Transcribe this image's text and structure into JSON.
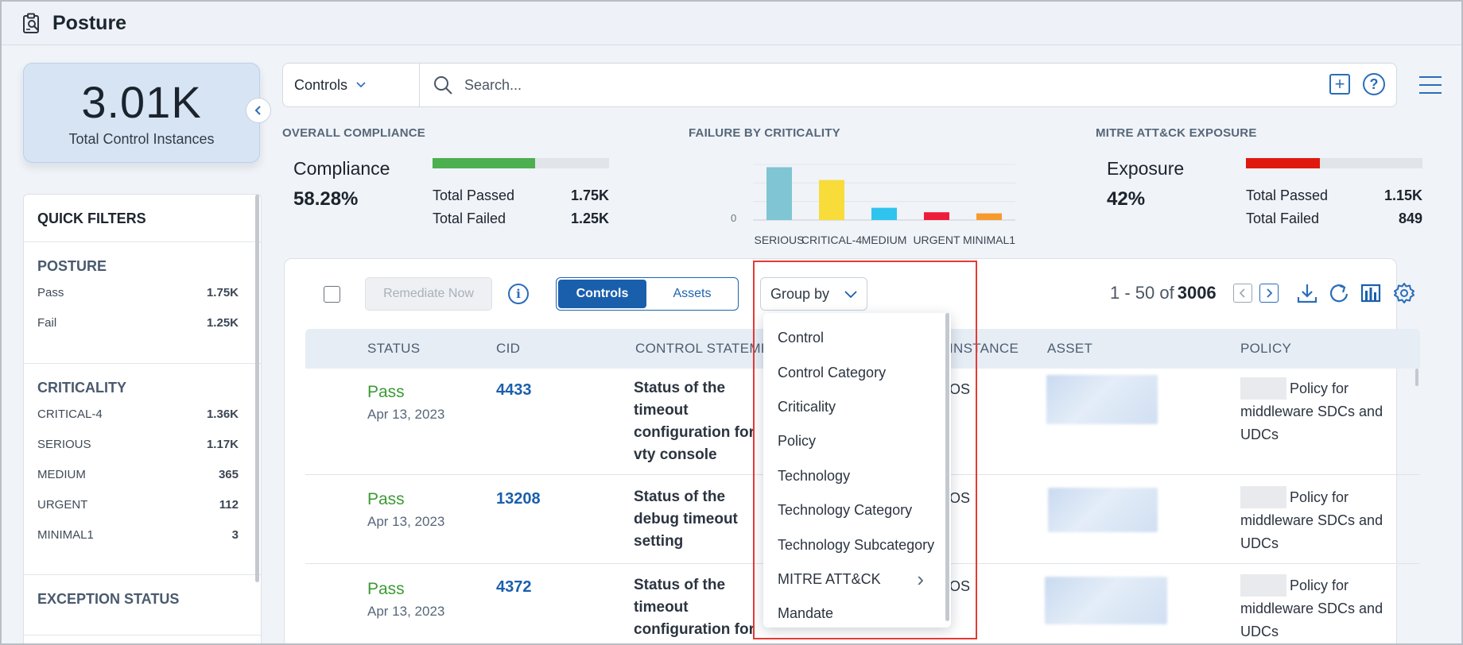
{
  "app": {
    "title": "Posture",
    "icon": "clipboard-search-icon"
  },
  "summary": {
    "value": "3.01K",
    "label": "Total Control Instances"
  },
  "quick_filters": {
    "title": "QUICK FILTERS",
    "posture": {
      "title": "POSTURE",
      "items": [
        {
          "label": "Pass",
          "count": "1.75K"
        },
        {
          "label": "Fail",
          "count": "1.25K"
        }
      ]
    },
    "criticality": {
      "title": "CRITICALITY",
      "items": [
        {
          "label": "CRITICAL-4",
          "count": "1.36K"
        },
        {
          "label": "SERIOUS",
          "count": "1.17K"
        },
        {
          "label": "MEDIUM",
          "count": "365"
        },
        {
          "label": "URGENT",
          "count": "112"
        },
        {
          "label": "MINIMAL1",
          "count": "3"
        }
      ]
    },
    "exception_status": {
      "title": "EXCEPTION STATUS"
    }
  },
  "search": {
    "scope": "Controls",
    "placeholder": "Search..."
  },
  "compliance": {
    "title": "OVERALL COMPLIANCE",
    "label": "Compliance",
    "percent": "58.28%",
    "passed_label": "Total Passed",
    "passed": "1.75K",
    "failed_label": "Total Failed",
    "failed": "1.25K",
    "fill_fraction": 0.58,
    "color": "#4caf50"
  },
  "failure": {
    "title": "FAILURE BY CRITICALITY"
  },
  "mitre": {
    "title": "MITRE ATT&CK EXPOSURE",
    "label": "Exposure",
    "percent": "42%",
    "passed_label": "Total Passed",
    "passed": "1.15K",
    "failed_label": "Total Failed",
    "failed": "849",
    "fill_fraction": 0.42,
    "color": "#e0190f"
  },
  "chart_data": {
    "type": "bar",
    "categories": [
      "SERIOUS",
      "CRITICAL-4",
      "MEDIUM",
      "URGENT",
      "MINIMAL1"
    ],
    "values": [
      0.95,
      0.72,
      0.22,
      0.14,
      0.12
    ],
    "colors": [
      "#7fc5d3",
      "#f7dc3a",
      "#2ec4ee",
      "#ee1d3a",
      "#f79a2e"
    ],
    "ylabel_tick": "0",
    "grid": true
  },
  "toolbar": {
    "remediate": "Remediate Now",
    "info": "i",
    "tabs": [
      "Controls",
      "Assets"
    ],
    "group_by": "Group by",
    "pager_range": "1 - 50 of",
    "pager_total": "3006"
  },
  "table": {
    "headers": [
      "STATUS",
      "CID",
      "CONTROL STATEME...",
      "INSTANCE",
      "ASSET",
      "POLICY"
    ],
    "rows": [
      {
        "status": "Pass",
        "date": "Apr 13, 2023",
        "cid": "4433",
        "statement": "Status of the timeout configuration for vty console",
        "instance": "OS",
        "policy": "Policy for middleware SDCs and UDCs"
      },
      {
        "status": "Pass",
        "date": "Apr 13, 2023",
        "cid": "13208",
        "statement": "Status of the debug timeout setting",
        "instance": "OS",
        "policy": "Policy for middleware SDCs and UDCs"
      },
      {
        "status": "Pass",
        "date": "Apr 13, 2023",
        "cid": "4372",
        "statement": "Status of the timeout configuration for",
        "instance": "OS",
        "policy": "Policy for middleware SDCs and UDCs"
      }
    ]
  },
  "group_by_menu": [
    "Control",
    "Control Category",
    "Criticality",
    "Policy",
    "Technology",
    "Technology Category",
    "Technology Subcategory",
    "MITRE ATT&CK",
    "Mandate"
  ]
}
